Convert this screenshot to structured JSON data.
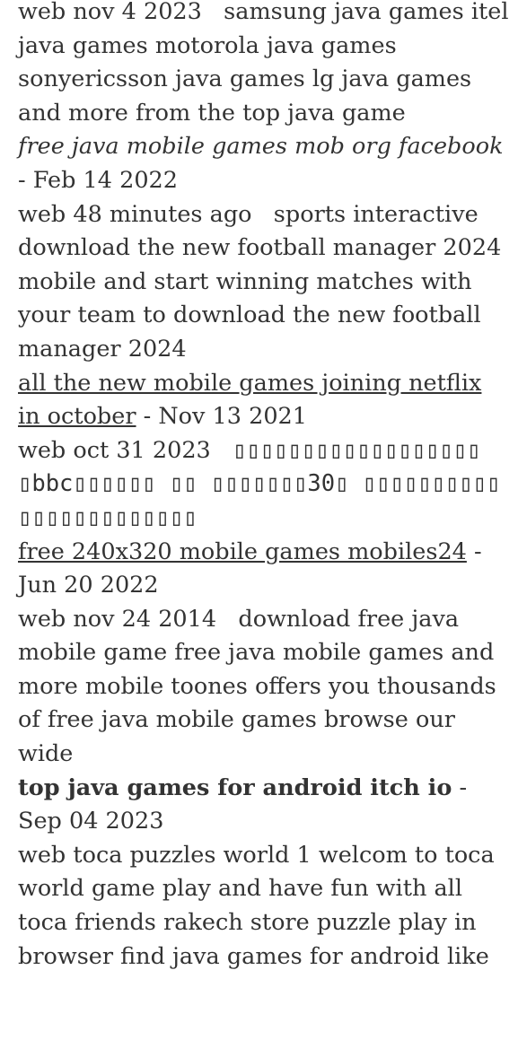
{
  "entries": [
    {
      "title": "",
      "date": "",
      "snippet": "web nov 4 2023   samsung java games itel java games motorola java games sonyericsson java games lg java games and more from the top java game"
    },
    {
      "title": "free java mobile games mob org facebook",
      "date": " - Feb 14 2022",
      "snippet": "web 48 minutes ago   sports interactive download the new football manager 2024 mobile and start winning matches with your team to download the new football manager 2024"
    },
    {
      "title": "all the new mobile games joining netflix in october",
      "date": " - Nov 13 2021",
      "snippet_prefix": "web oct 31 2023   ",
      "snippet_cjk": "▯▯▯▯▯▯▯▯▯▯▯▯▯▯▯▯▯▯ ▯bbc▯▯▯▯▯▯ ▯▯ ▯▯▯▯▯▯▯30▯ ▯▯▯▯▯▯▯▯▯▯ ▯▯▯▯▯▯▯▯▯▯▯▯▯"
    },
    {
      "title": "free 240x320 mobile games mobiles24",
      "date": " - Jun 20 2022",
      "snippet": "web nov 24 2014   download free java mobile game free java mobile games and more mobile toones offers you thousands of free java mobile games browse our wide"
    },
    {
      "title": "top java games for android itch io",
      "date": " - Sep 04 2023",
      "snippet": "web toca puzzles world 1 welcom to toca world game play and have fun with all toca friends rakech store puzzle play in browser find java games for android like"
    }
  ]
}
